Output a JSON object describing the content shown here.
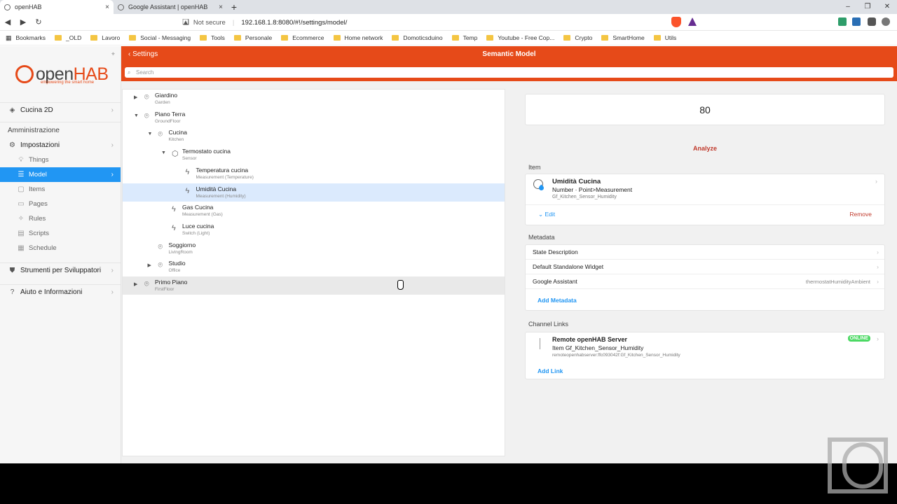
{
  "browser": {
    "tabs": [
      {
        "title": "openHAB",
        "close": "×"
      },
      {
        "title": "Google Assistant | openHAB",
        "close": "×"
      }
    ],
    "new_tab": "+",
    "window_controls": [
      "–",
      "❐",
      "✕"
    ],
    "nav": {
      "back": "◀",
      "forward": "▶",
      "reload": "↻",
      "bookmark": "❏"
    },
    "security": "Not secure",
    "url": "192.168.1.8:8080/#!/settings/model/",
    "bookmarks": [
      "Bookmarks",
      "_OLD",
      "Lavoro",
      "Social - Messaging",
      "Tools",
      "Personale",
      "Ecommerce",
      "Home network",
      "Domoticsduino",
      "Temp",
      "Youtube - Free Cop...",
      "Crypto",
      "SmartHome",
      "Utils"
    ]
  },
  "sidebar": {
    "logo": {
      "open": "open",
      "hab": "HAB",
      "tagline": "empowering the smart home"
    },
    "pin": "⌖",
    "top_item": "Cucina 2D",
    "section": "Amministrazione",
    "settings_label": "Impostazioni",
    "sub_items": [
      "Things",
      "Model",
      "Items",
      "Pages",
      "Rules",
      "Scripts",
      "Schedule"
    ],
    "dev_tools": "Strumenti per Sviluppatori",
    "help": "Aiuto e Informazioni",
    "chevron": "›"
  },
  "header": {
    "back_label": "Settings",
    "title": "Semantic Model",
    "search_placeholder": "Search"
  },
  "tree": [
    {
      "label": "Giardino",
      "sub": "Garden",
      "arrow": "▶",
      "icon": "⌾"
    },
    {
      "label": "Piano Terra",
      "sub": "GroundFloor",
      "arrow": "▼",
      "icon": "⌾"
    },
    {
      "label": "Cucina",
      "sub": "Kitchen",
      "arrow": "▼",
      "icon": "⌾"
    },
    {
      "label": "Termostato cucina",
      "sub": "Sensor",
      "arrow": "▼",
      "icon": "⬡"
    },
    {
      "label": "Temperatura cucina",
      "sub": "Measurement (Temperature)",
      "arrow": "",
      "icon": "ϟ"
    },
    {
      "label": "Umidità Cucina",
      "sub": "Measurement (Humidity)",
      "arrow": "",
      "icon": "ϟ"
    },
    {
      "label": "Gas Cucina",
      "sub": "Measurement (Gas)",
      "arrow": "",
      "icon": "ϟ"
    },
    {
      "label": "Luce cucina",
      "sub": "Switch (Light)",
      "arrow": "",
      "icon": "ϟ"
    },
    {
      "label": "Soggiorno",
      "sub": "LivingRoom",
      "arrow": "",
      "icon": "⌾"
    },
    {
      "label": "Studio",
      "sub": "Office",
      "arrow": "▶",
      "icon": "⌾"
    },
    {
      "label": "Primo Piano",
      "sub": "FirstFloor",
      "arrow": "▶",
      "icon": "⌾"
    }
  ],
  "detail": {
    "state": "80",
    "analyze": "Analyze",
    "item_section": "Item",
    "item": {
      "name": "Umidità Cucina",
      "type": "Number · Point>Measurement",
      "id": "Gf_Kitchen_Sensor_Humidity",
      "edit": "Edit",
      "remove": "Remove"
    },
    "metadata_section": "Metadata",
    "metadata": [
      {
        "label": "State Description",
        "value": ""
      },
      {
        "label": "Default Standalone Widget",
        "value": ""
      },
      {
        "label": "Google Assistant",
        "value": "thermostatHumidityAmbient"
      }
    ],
    "add_metadata": "Add Metadata",
    "links_section": "Channel Links",
    "link": {
      "name": "Remote openHAB Server",
      "item": "Item Gf_Kitchen_Sensor_Humidity",
      "id": "remoteopenhabserver:ffc093042f:Gf_Kitchen_Sensor_Humidity",
      "status": "ONLINE"
    },
    "add_link": "Add Link"
  },
  "colors": {
    "accent": "#e64a19",
    "selection": "#2196f3",
    "online": "#4cd964",
    "danger": "#c0392b"
  }
}
